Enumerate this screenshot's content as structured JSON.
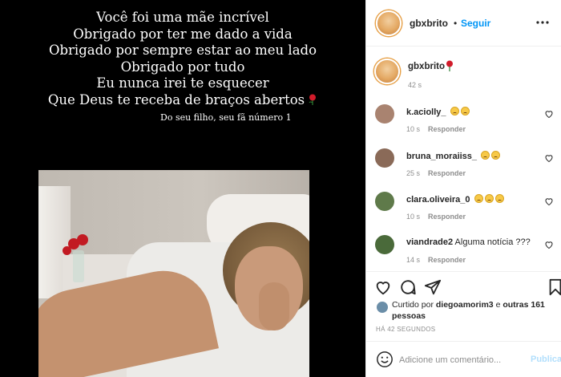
{
  "poem": {
    "lines": [
      "Você foi uma mãe incrível",
      "Obrigado por ter me dado a vida",
      "Obrigado por sempre estar ao meu lado",
      "Obrigado por tudo",
      "Eu nunca irei te esquecer",
      "Que Deus te receba de braços abertos"
    ],
    "signature": "Do seu filho, seu fã número 1"
  },
  "header": {
    "username": "gbxbrito",
    "separator": "•",
    "follow_label": "Seguir"
  },
  "caption": {
    "username": "gbxbrito",
    "time": "42 s"
  },
  "comments": [
    {
      "username": "k.aciolly_",
      "text": "",
      "time": "10 s",
      "reply": "Responder",
      "emojis": 2,
      "avatar_color": "#a98370"
    },
    {
      "username": "bruna_moraiiss_",
      "text": "",
      "time": "25 s",
      "reply": "Responder",
      "emojis": 2,
      "avatar_color": "#8a6a58"
    },
    {
      "username": "clara.oliveira_0",
      "text": "",
      "time": "10 s",
      "reply": "Responder",
      "emojis": 3,
      "avatar_color": "#5f7a4a"
    },
    {
      "username": "viandrade2",
      "text": "Alguma notícia ???",
      "time": "14 s",
      "reply": "Responder",
      "emojis": 0,
      "avatar_color": "#4a6a3a"
    }
  ],
  "likes": {
    "prefix": "Curtido por",
    "user": "diegoamorim3",
    "middle": "e",
    "others": "outras 161 pessoas"
  },
  "posted_ago": "HÁ 42 SEGUNDOS",
  "add_comment": {
    "placeholder": "Adicione um comentário...",
    "publish_label": "Publicar"
  },
  "colors": {
    "accent": "#0095f6",
    "publish_disabled": "#b2dffc",
    "muted": "#8e8e8e"
  },
  "icons": [
    "more-icon",
    "heart-icon",
    "comment-icon",
    "share-icon",
    "bookmark-icon",
    "smile-icon",
    "rose-icon"
  ]
}
